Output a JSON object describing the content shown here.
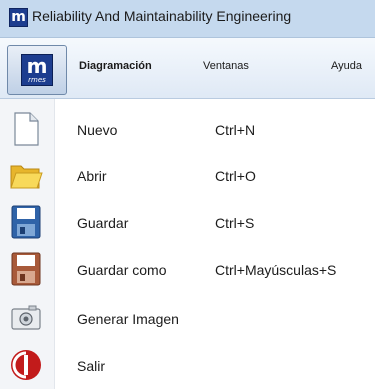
{
  "window": {
    "title": "Reliability And Maintainability Engineering",
    "logo_letter": "m"
  },
  "app_button": {
    "logo_letter": "m",
    "logo_caption": "rmes"
  },
  "menubar": {
    "tabs": [
      {
        "label": "Diagramación"
      },
      {
        "label": "Ventanas"
      },
      {
        "label": "Ayuda"
      }
    ]
  },
  "menu": {
    "items": [
      {
        "label": "Nuevo",
        "shortcut": "Ctrl+N",
        "icon": "new-file-icon"
      },
      {
        "label": "Abrir",
        "shortcut": "Ctrl+O",
        "icon": "folder-icon"
      },
      {
        "label": "Guardar",
        "shortcut": "Ctrl+S",
        "icon": "save-icon"
      },
      {
        "label": "Guardar como",
        "shortcut": "Ctrl+Mayúsculas+S",
        "icon": "save-as-icon"
      },
      {
        "label": "Generar Imagen",
        "shortcut": "",
        "icon": "camera-icon"
      },
      {
        "label": "Salir",
        "shortcut": "",
        "icon": "exit-icon"
      }
    ]
  },
  "colors": {
    "titlebar": "#c5d9ee",
    "brand_blue": "#1d3d8f",
    "exit_red": "#c21b1b"
  }
}
